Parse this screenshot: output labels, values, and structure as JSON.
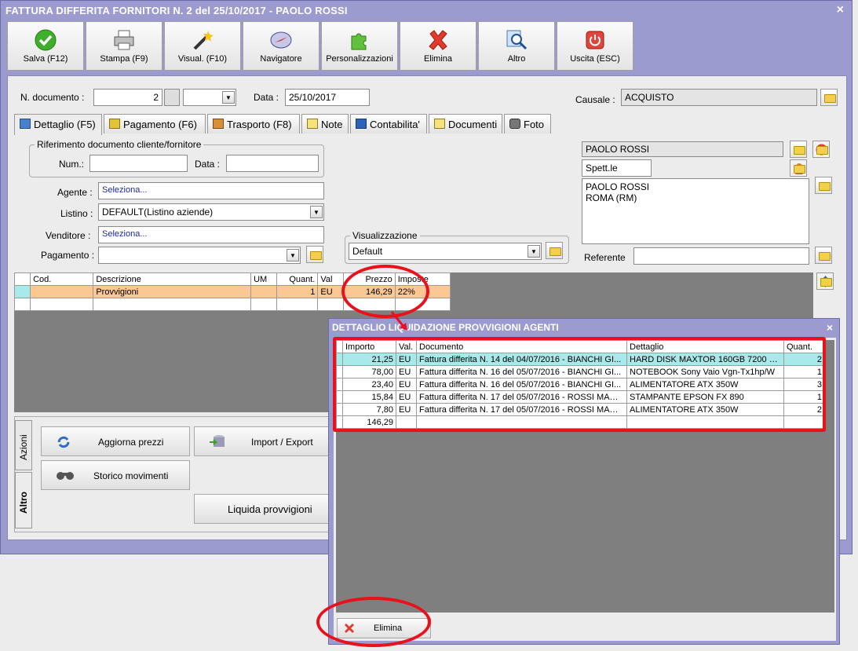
{
  "window": {
    "title": "FATTURA DIFFERITA FORNITORI N. 2 del 25/10/2017 - PAOLO ROSSI",
    "close": "×"
  },
  "toolbar": [
    {
      "label": "Salva (F12)",
      "icon": "check-icon"
    },
    {
      "label": "Stampa (F9)",
      "icon": "printer-icon"
    },
    {
      "label": "Visual. (F10)",
      "icon": "magic-wand-icon"
    },
    {
      "label": "Navigatore",
      "icon": "compass-icon"
    },
    {
      "label": "Personalizzazioni",
      "icon": "puzzle-icon"
    },
    {
      "label": "Elimina",
      "icon": "delete-x-icon"
    },
    {
      "label": "Altro",
      "icon": "magnifier-icon"
    },
    {
      "label": "Uscita (ESC)",
      "icon": "power-icon"
    }
  ],
  "header": {
    "doc_label": "N. documento :",
    "doc_value": "2",
    "date_label": "Data :",
    "date_value": "25/10/2017",
    "causale_label": "Causale :",
    "causale_value": "ACQUISTO"
  },
  "tabs": [
    "Dettaglio (F5)",
    "Pagamento (F6)",
    "Trasporto (F8)",
    "Note",
    "Contabilita'",
    "Documenti",
    "Foto"
  ],
  "riferimento": {
    "legend": "Riferimento documento cliente/fornitore",
    "num_label": "Num.:",
    "data_label": "Data :"
  },
  "fields": {
    "agente_label": "Agente :",
    "agente_value": "Seleziona...",
    "listino_label": "Listino :",
    "listino_value": "DEFAULT(Listino aziende)",
    "venditore_label": "Venditore :",
    "venditore_value": "Seleziona...",
    "pagamento_label": "Pagamento :"
  },
  "visualizzazione": {
    "legend": "Visualizzazione",
    "value": "Default"
  },
  "cliente": {
    "name": "PAOLO ROSSI",
    "title": "Spett.le",
    "address_line1": "PAOLO ROSSI",
    "address_line2": "ROMA (RM)",
    "referente_label": "Referente"
  },
  "grid": {
    "headers": [
      "Cod.",
      "Descrizione",
      "UM",
      "Quant.",
      "Val",
      "Prezzo",
      "Imposte"
    ],
    "rows": [
      [
        "",
        "Provvigioni",
        "",
        "1",
        "EU",
        "146,29",
        "22%"
      ]
    ]
  },
  "side_tabs": {
    "azioni": "Azioni",
    "altro": "Altro"
  },
  "actions": {
    "aggiorna": "Aggiorna prezzi",
    "import": "Import / Export",
    "storico": "Storico movimenti",
    "liquida": "Liquida provvigioni"
  },
  "popup": {
    "title": "DETTAGLIO LIQUIDAZIONE PROVVIGIONI AGENTI",
    "close": "×",
    "headers": [
      "Importo",
      "Val.",
      "Documento",
      "Dettaglio",
      "Quant."
    ],
    "rows": [
      [
        "21,25",
        "EU",
        "Fattura differita N. 14 del 04/07/2016 - BIANCHI GI...",
        "HARD DISK MAXTOR 160GB 7200 RP...",
        "2"
      ],
      [
        "78,00",
        "EU",
        "Fattura differita N. 16 del 05/07/2016 - BIANCHI GI...",
        "NOTEBOOK Sony Vaio Vgn-Tx1hp/W",
        "1"
      ],
      [
        "23,40",
        "EU",
        "Fattura differita N. 16 del 05/07/2016 - BIANCHI GI...",
        "ALIMENTATORE ATX 350W",
        "3"
      ],
      [
        "15,84",
        "EU",
        "Fattura differita N. 17 del 05/07/2016 - ROSSI MARIO",
        "STAMPANTE EPSON FX 890",
        "1"
      ],
      [
        "7,80",
        "EU",
        "Fattura differita N. 17 del 05/07/2016 - ROSSI MARIO",
        "ALIMENTATORE ATX 350W",
        "2"
      ]
    ],
    "total": "146,29",
    "delete_label": "Elimina"
  },
  "colors": {
    "window_bg": "#9b9bcf",
    "highlight_row": "#fbc893",
    "selected_row": "#a8e9ea",
    "annotation_red": "#e8111c"
  }
}
